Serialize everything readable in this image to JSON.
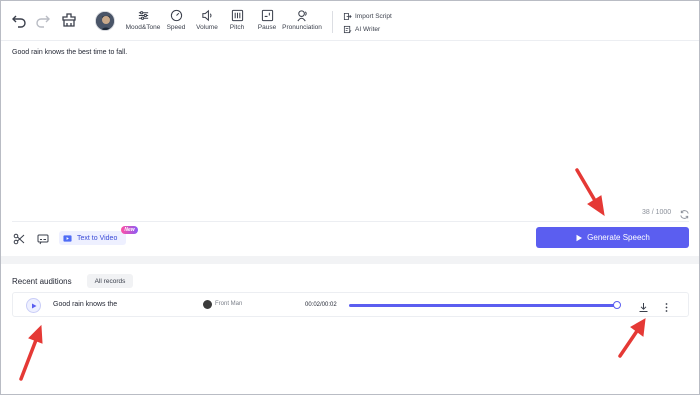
{
  "toolbar": {
    "tools": [
      {
        "label": "Mood&Tone",
        "icon": "sliders-icon"
      },
      {
        "label": "Speed",
        "icon": "speed-icon"
      },
      {
        "label": "Volume",
        "icon": "volume-icon"
      },
      {
        "label": "Pitch",
        "icon": "pitch-icon"
      },
      {
        "label": "Pause",
        "icon": "pause-icon"
      },
      {
        "label": "Pronunciation",
        "icon": "pronunciation-icon"
      }
    ],
    "import_script": "Import Script",
    "ai_writer": "AI Writer"
  },
  "editor": {
    "text": "Good rain knows the best time to fall.",
    "char_count": "38 / 1000"
  },
  "bottom_bar": {
    "text_to_video": "Text to Video",
    "new_badge": "New",
    "generate_label": "Generate Speech"
  },
  "recent": {
    "title": "Recent auditions",
    "all_records": "All records",
    "items": [
      {
        "text": "Good rain knows the",
        "voice": "Front Man",
        "time": "00:02/00:02",
        "progress": 1.0
      }
    ]
  },
  "colors": {
    "accent": "#5b5ef0",
    "annotation": "#e53935"
  }
}
